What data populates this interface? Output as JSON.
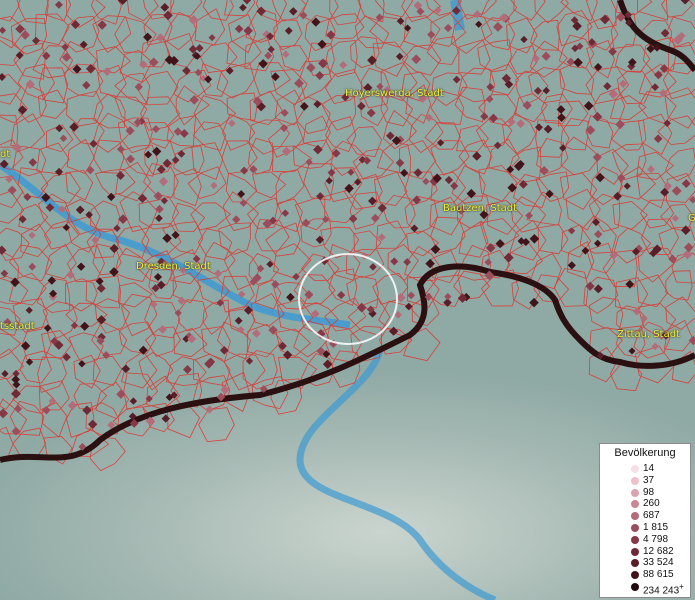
{
  "map": {
    "places": [
      {
        "name": "Hoyerswerda, Stadt"
      },
      {
        "name": "Bautzen, Stadt"
      },
      {
        "name": "Dresden, Stadt"
      },
      {
        "name": "Zittau, Stadt"
      },
      {
        "name": "tsstadt"
      },
      {
        "name": "dt"
      },
      {
        "name": "G"
      }
    ],
    "colors": {
      "terrain": "#8fa9a5",
      "border": "#e0352e",
      "river": "#3d9ad1",
      "national_border": "#2a1010",
      "label": "#f2ef3a"
    }
  },
  "legend": {
    "title": "Bevölkerung",
    "items": [
      {
        "label": "14",
        "color": "#f6dfe6"
      },
      {
        "label": "37",
        "color": "#ecc1cc"
      },
      {
        "label": "98",
        "color": "#dca2b0"
      },
      {
        "label": "260",
        "color": "#c98894"
      },
      {
        "label": "687",
        "color": "#b36c79"
      },
      {
        "label": "1 815",
        "color": "#9c4d5c"
      },
      {
        "label": "4 798",
        "color": "#863847"
      },
      {
        "label": "12 682",
        "color": "#702a36"
      },
      {
        "label": "33 524",
        "color": "#591e27"
      },
      {
        "label": "88 615",
        "color": "#41141a"
      },
      {
        "label": "234 243",
        "color": "#240a0e"
      }
    ],
    "overflow_marker": "+"
  }
}
